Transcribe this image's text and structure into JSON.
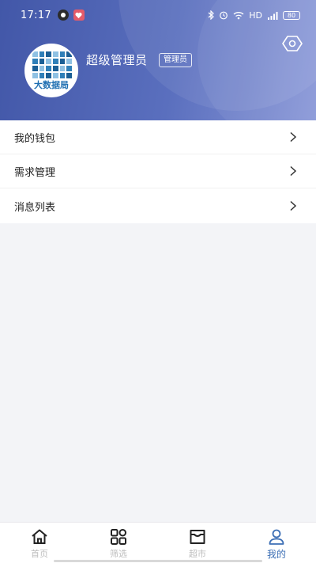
{
  "status": {
    "time": "17:17",
    "network": "HD",
    "battery": "80"
  },
  "profile": {
    "avatar_text": "大数据局",
    "name": "超级管理员",
    "role": "管理员"
  },
  "menu": [
    {
      "label": "我的钱包"
    },
    {
      "label": "需求管理"
    },
    {
      "label": "消息列表"
    }
  ],
  "tabs": [
    {
      "label": "首页",
      "icon": "home-icon"
    },
    {
      "label": "筛选",
      "icon": "grid-icon"
    },
    {
      "label": "超市",
      "icon": "store-icon"
    },
    {
      "label": "我的",
      "icon": "user-icon",
      "active": true
    }
  ],
  "colors": {
    "header_start": "#4257a8",
    "header_end": "#8a98d8",
    "accent": "#3d6fb5"
  }
}
